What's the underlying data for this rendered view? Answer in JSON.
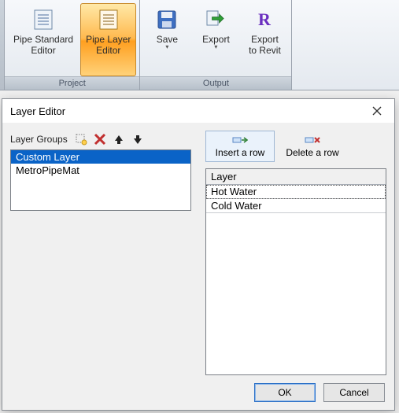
{
  "ribbon": {
    "groups": [
      {
        "title": "Project",
        "buttons": [
          {
            "label": "Pipe Standard\nEditor",
            "icon": "document-icon",
            "active": false
          },
          {
            "label": "Pipe Layer\nEditor",
            "icon": "document-icon",
            "active": true
          }
        ]
      },
      {
        "title": "Output",
        "buttons": [
          {
            "label": "Save",
            "icon": "save-icon",
            "active": false,
            "dropdown": true
          },
          {
            "label": "Export",
            "icon": "export-icon",
            "active": false,
            "dropdown": true
          },
          {
            "label": "Export\nto Revit",
            "icon": "revit-icon",
            "active": false
          }
        ]
      }
    ]
  },
  "dialog": {
    "title": "Layer Editor",
    "layer_groups_label": "Layer Groups",
    "layer_groups": [
      {
        "name": "Custom Layer",
        "selected": true
      },
      {
        "name": "MetroPipeMat",
        "selected": false
      }
    ],
    "row_toolbar": {
      "insert": "Insert a row",
      "delete": "Delete a row"
    },
    "grid": {
      "header": "Layer",
      "rows": [
        {
          "name": "Hot Water",
          "selected": true
        },
        {
          "name": "Cold Water",
          "selected": false
        }
      ]
    },
    "buttons": {
      "ok": "OK",
      "cancel": "Cancel"
    }
  }
}
